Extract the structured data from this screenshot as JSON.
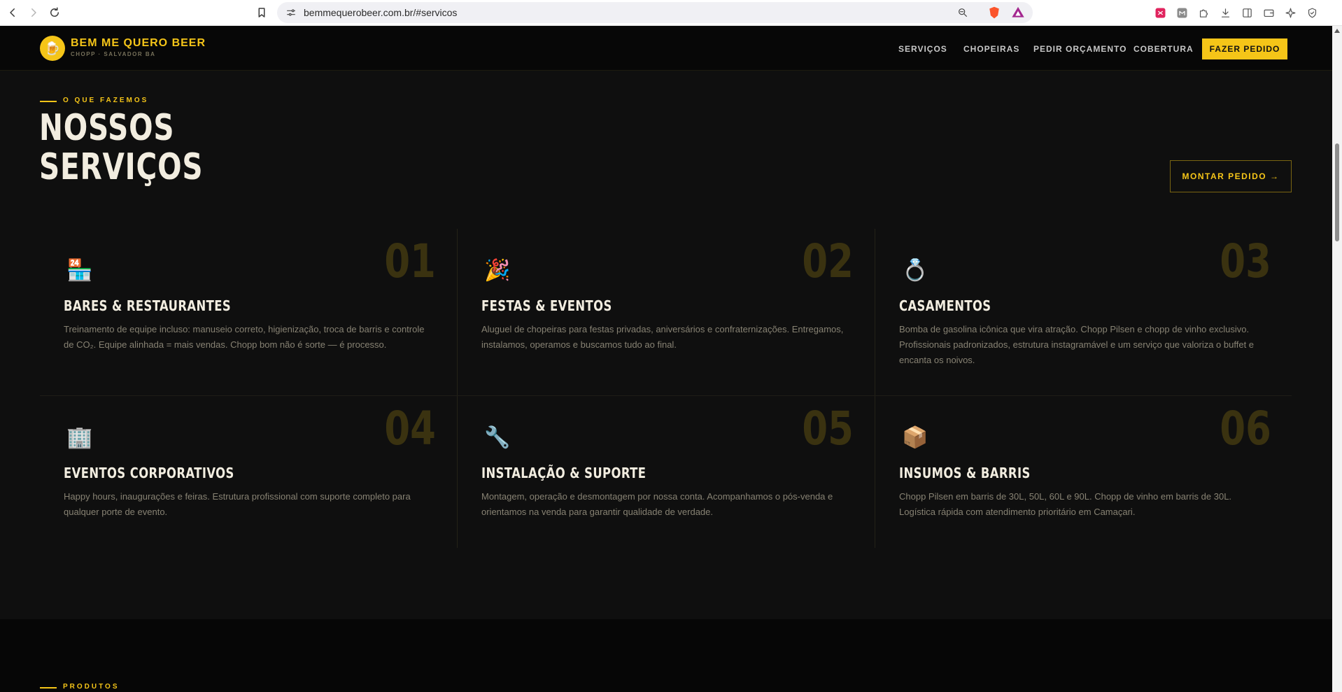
{
  "browser": {
    "url": "bemmequerobeer.com.br/#servicos"
  },
  "header": {
    "logo_emoji": "🍺",
    "brand": "BEM ME QUERO BEER",
    "tagline": "CHOPP · SALVADOR BA",
    "nav": [
      "SERVIÇOS",
      "CHOPEIRAS",
      "PEDIR ORÇAMENTO",
      "COBERTURA"
    ],
    "cta": "FAZER PEDIDO"
  },
  "section": {
    "eyebrow": "O QUE FAZEMOS",
    "title_line1": "NOSSOS",
    "title_line2": "SERVIÇOS",
    "button": "MONTAR PEDIDO →"
  },
  "services": [
    {
      "num": "01",
      "icon": "🏪",
      "title": "BARES & RESTAURANTES",
      "desc": "Treinamento de equipe incluso: manuseio correto, higienização, troca de barris e controle de CO₂. Equipe alinhada = mais vendas. Chopp bom não é sorte — é processo."
    },
    {
      "num": "02",
      "icon": "🎉",
      "title": "FESTAS & EVENTOS",
      "desc": "Aluguel de chopeiras para festas privadas, aniversários e confraternizações. Entregamos, instalamos, operamos e buscamos tudo ao final."
    },
    {
      "num": "03",
      "icon": "💍",
      "title": "CASAMENTOS",
      "desc": "Bomba de gasolina icônica que vira atração. Chopp Pilsen e chopp de vinho exclusivo. Profissionais padronizados, estrutura instagramável e um serviço que valoriza o buffet e encanta os noivos."
    },
    {
      "num": "04",
      "icon": "🏢",
      "title": "EVENTOS CORPORATIVOS",
      "desc": "Happy hours, inaugurações e feiras. Estrutura profissional com suporte completo para qualquer porte de evento."
    },
    {
      "num": "05",
      "icon": "🔧",
      "title": "INSTALAÇÃO & SUPORTE",
      "desc": "Montagem, operação e desmontagem por nossa conta. Acompanhamos o pós-venda e orientamos na venda para garantir qualidade de verdade."
    },
    {
      "num": "06",
      "icon": "📦",
      "title": "INSUMOS & BARRIS",
      "desc": "Chopp Pilsen em barris de 30L, 50L, 60L e 90L. Chopp de vinho em barris de 30L. Logística rápida com atendimento prioritário em Camaçari."
    }
  ],
  "next_section": {
    "eyebrow": "PRODUTOS"
  }
}
